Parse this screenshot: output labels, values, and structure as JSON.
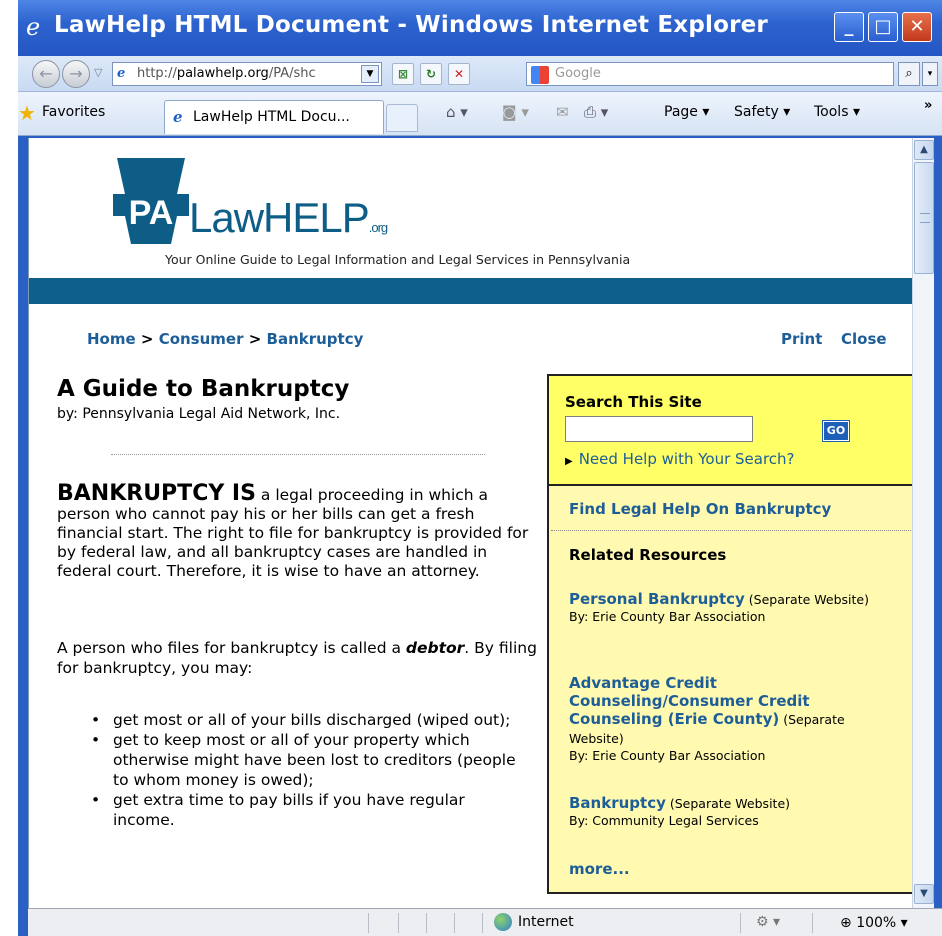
{
  "window": {
    "title": "LawHelp HTML Document - Windows Internet Explorer",
    "url_prefix": "http://",
    "url_host": "palawhelp.org",
    "url_rest": "/PA/shc",
    "search_placeholder": "Google"
  },
  "toolbar": {
    "favorites_label": "Favorites",
    "tab_label": "LawHelp HTML Docu...",
    "page_label": "Page ▾",
    "safety_label": "Safety ▾",
    "tools_label": "Tools ▾",
    "more_label": "»"
  },
  "status": {
    "zone_label": "Internet",
    "zoom_label": "100%",
    "zoom_drop": "▾"
  },
  "site": {
    "logo_word": "LawHELP",
    "logo_org": ".org",
    "logo_badge": "PA",
    "tagline": "Your Online Guide to Legal Information and Legal Services in Pennsylvania"
  },
  "breadcrumb": {
    "home": "Home",
    "sep": " > ",
    "consumer": "Consumer",
    "bankruptcy": "Bankruptcy"
  },
  "actions": {
    "print": "Print",
    "close": "Close"
  },
  "article": {
    "title": "A Guide to Bankruptcy",
    "byline": "by: Pennsylvania Legal Aid Network, Inc.",
    "lead": "BANKRUPTCY IS",
    "para1": " a legal proceeding in which a person who cannot pay his or her bills can get a fresh financial start. The right to file for bankruptcy is provided for by federal law, and all bankruptcy cases are handled in federal court. Therefore, it is wise to have an attorney.",
    "para2_a": "A person who files for bankruptcy is called a ",
    "para2_term": "debtor",
    "para2_b": ". By filing for bankruptcy, you may:",
    "bullets": [
      "get most or all of your bills discharged (wiped out);",
      "get to keep most or all of your property which otherwise might have been lost to creditors (people to whom money is owed);",
      "get extra time to pay bills if you have regular income."
    ]
  },
  "sidebar": {
    "search_title": "Search This Site",
    "search_go": "GO",
    "search_help": "Need Help with Your Search?",
    "find_help": "Find Legal Help On Bankruptcy",
    "related_title": "Related Resources",
    "resources": [
      {
        "title": "Personal Bankruptcy",
        "note": " (Separate Website)",
        "by": "By: Erie County Bar Association"
      },
      {
        "title": "Advantage Credit Counseling/Consumer Credit Counseling (Erie County)",
        "note": " (Separate Website)",
        "by": "By: Erie County Bar Association"
      },
      {
        "title": "Bankruptcy",
        "note": " (Separate Website)",
        "by": "By: Community Legal Services"
      }
    ],
    "more": "more..."
  },
  "colors": {
    "title_bar": "#2456c4",
    "link_blue": "#1d5e98",
    "search_panel": "#ffff66",
    "site_bar": "#0f5f8c"
  }
}
